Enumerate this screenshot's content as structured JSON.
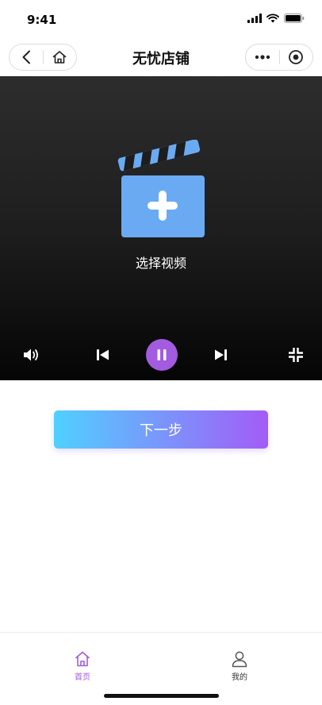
{
  "status_bar": {
    "time": "9:41"
  },
  "nav": {
    "title": "无忧店铺",
    "back_icon": "back-chevron-icon",
    "home_icon": "home-icon",
    "more_icon": "more-dots-icon",
    "close_icon": "target-close-icon"
  },
  "player": {
    "select_label": "选择视频",
    "clapper_icon": "clapperboard-add-icon",
    "controls": {
      "volume_icon": "volume-icon",
      "prev_icon": "skip-previous-icon",
      "pause_icon": "pause-icon",
      "next_icon": "skip-next-icon",
      "fullscreen_icon": "exit-fullscreen-icon"
    }
  },
  "next_button": {
    "label": "下一步"
  },
  "tab_bar": {
    "items": [
      {
        "label": "首页",
        "icon": "home-icon",
        "active": true
      },
      {
        "label": "我的",
        "icon": "person-icon",
        "active": false
      }
    ]
  },
  "colors": {
    "accent": "#a35be0",
    "gradient_start": "#50d0ff",
    "gradient_end": "#a35cf7",
    "clapper_blue": "#6aaaf3"
  }
}
